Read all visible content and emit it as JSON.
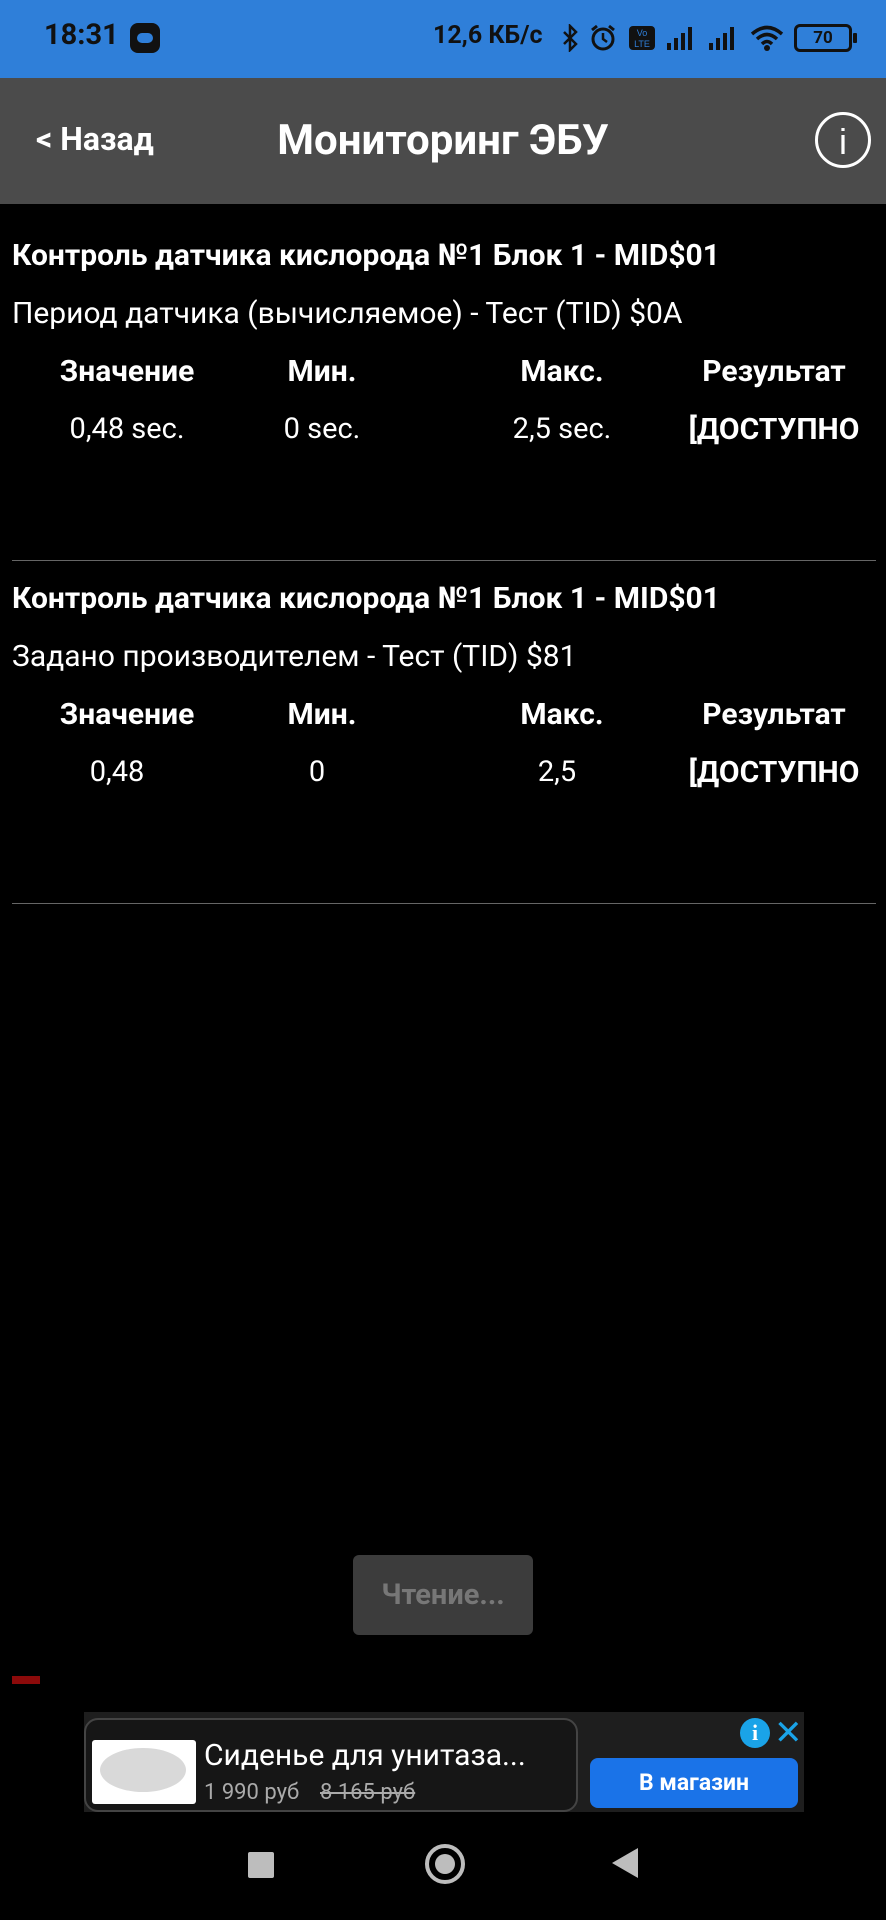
{
  "status_bar": {
    "time": "18:31",
    "speed": "12,6 КБ/с",
    "battery": "70",
    "icons": [
      "bluetooth-icon",
      "alarm-icon",
      "volte-icon",
      "signal-icon",
      "signal-icon",
      "wifi-icon",
      "battery-icon"
    ]
  },
  "header": {
    "back_label": "< Назад",
    "title": "Мониторинг ЭБУ",
    "info_icon": "info-icon"
  },
  "monitors": [
    {
      "title": "Контроль датчика кислорода №1 Блок 1 - MID$01",
      "subtitle": "Период датчика (вычисляемое) - Тест (TID) $0A",
      "headers": [
        "Значение",
        "Мин.",
        "Макс.",
        "Результат"
      ],
      "value": "0,48  sec.",
      "min": "0  sec.",
      "max": "2,5  sec.",
      "result": "[ДОСТУПНО"
    },
    {
      "title": "Контроль датчика кислорода №1 Блок 1 - MID$01",
      "subtitle": "Задано производителем - Тест (TID) $81",
      "headers": [
        "Значение",
        "Мин.",
        "Макс.",
        "Результат"
      ],
      "value": "0,48",
      "min": "0",
      "max": "2,5",
      "result": "[ДОСТУПНО"
    }
  ],
  "reading_button": "Чтение...",
  "ad": {
    "title": "Сиденье для унитаза...",
    "price": "1 990 руб",
    "old_price": "8 165 руб",
    "cta": "В магазин",
    "adchoices": "i",
    "close": "✕"
  },
  "navbar": [
    "recents-icon",
    "home-icon",
    "back-icon"
  ]
}
